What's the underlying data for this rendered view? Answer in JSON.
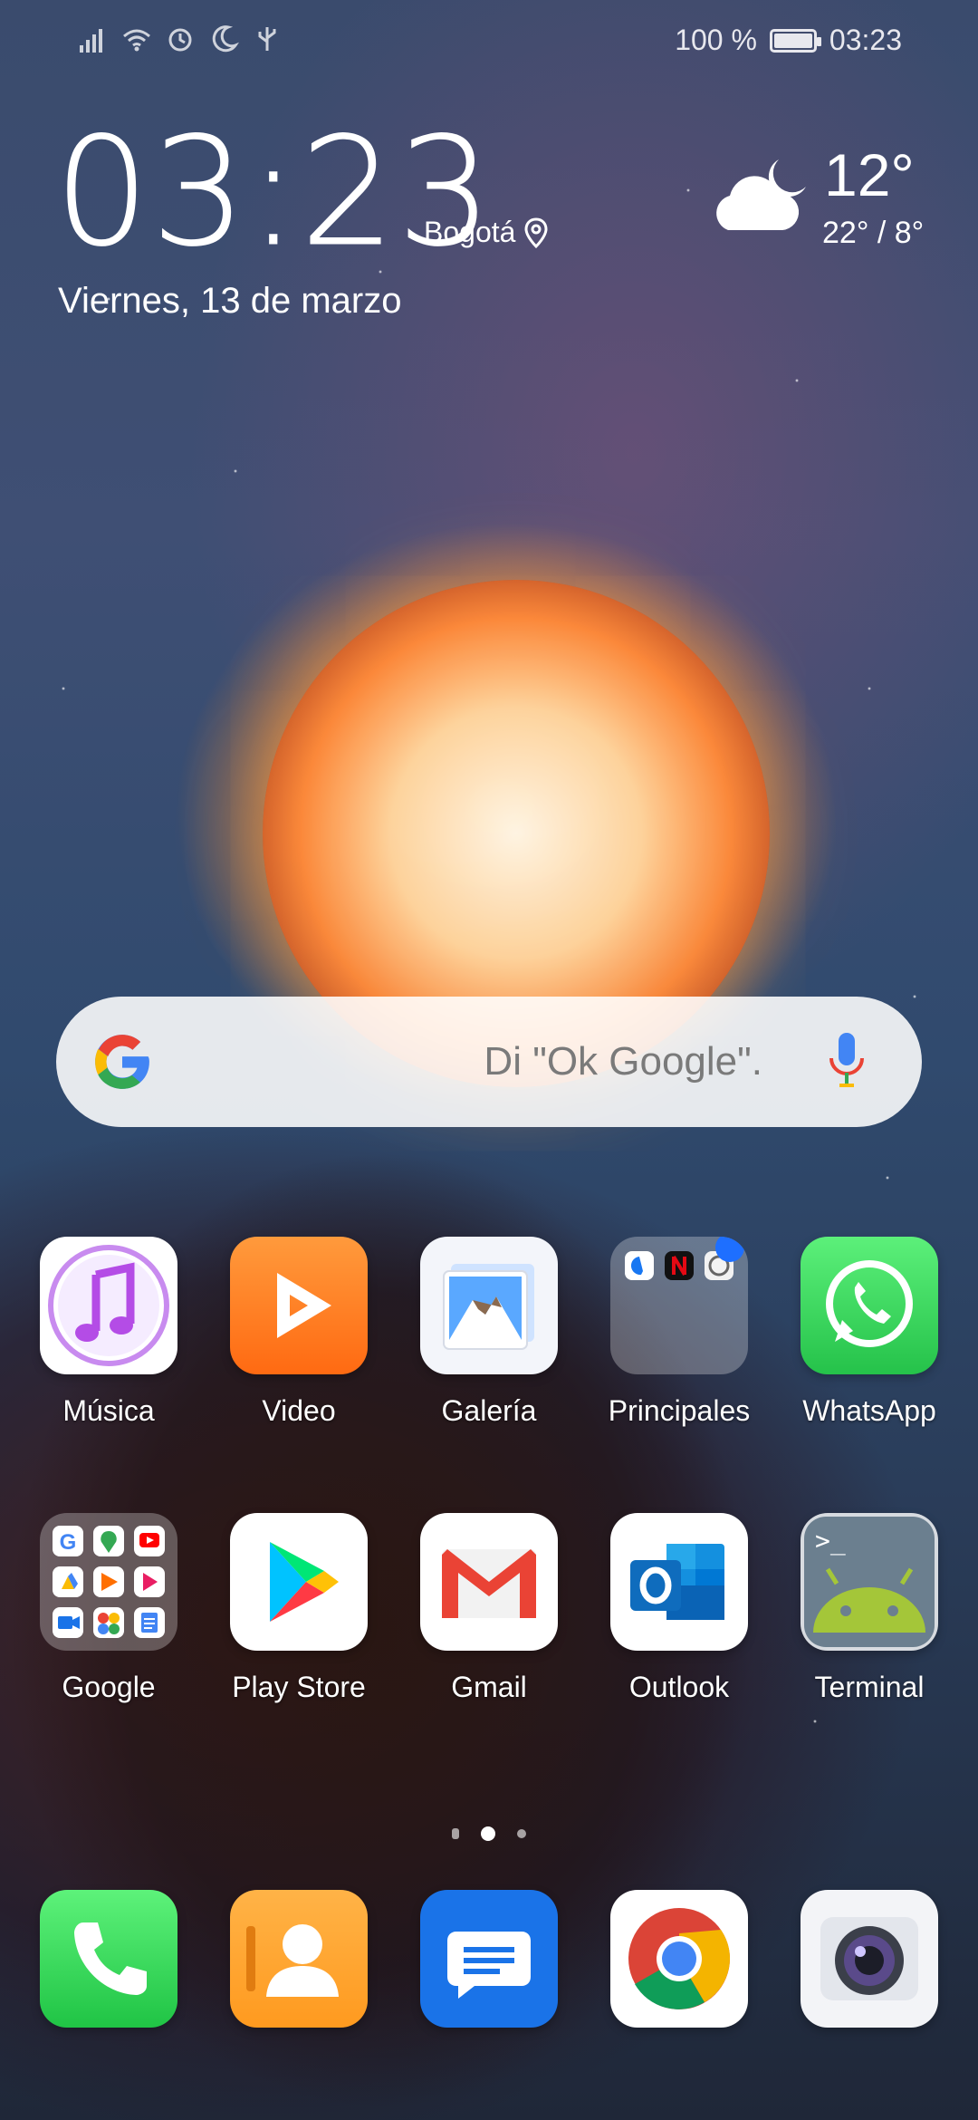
{
  "status_bar": {
    "battery_text": "100 %",
    "battery_level": 1.0,
    "time": "03:23",
    "icons": [
      "signal-icon",
      "wifi-icon",
      "alarm-icon",
      "do-not-disturb-icon",
      "usb-icon"
    ]
  },
  "clock_widget": {
    "time": "03:23",
    "city": "Bogotá",
    "date": "Viernes, 13 de marzo",
    "temperature": "12°",
    "range": "22° / 8°",
    "weather": "partly-cloudy-night-icon"
  },
  "search": {
    "hint": "Di \"Ok Google\"."
  },
  "apps_row1": [
    {
      "label": "Música",
      "icon": "music-icon"
    },
    {
      "label": "Video",
      "icon": "video-icon"
    },
    {
      "label": "Galería",
      "icon": "gallery-icon"
    },
    {
      "label": "Principales",
      "icon": "folder-icon"
    },
    {
      "label": "WhatsApp",
      "icon": "whatsapp-icon"
    }
  ],
  "apps_row2": [
    {
      "label": "Google",
      "icon": "google-folder-icon"
    },
    {
      "label": "Play Store",
      "icon": "play-store-icon"
    },
    {
      "label": "Gmail",
      "icon": "gmail-icon"
    },
    {
      "label": "Outlook",
      "icon": "outlook-icon"
    },
    {
      "label": "Terminal",
      "icon": "terminal-icon"
    }
  ],
  "dock": [
    {
      "icon": "phone-icon"
    },
    {
      "icon": "contacts-icon"
    },
    {
      "icon": "messages-icon"
    },
    {
      "icon": "chrome-icon"
    },
    {
      "icon": "camera-icon"
    }
  ],
  "colors": {
    "whatsapp": "#25D366",
    "video": "#FF7A1A",
    "messages": "#1A73E8",
    "phone": "#34C759",
    "contacts": "#FFA52A",
    "notification_dot": "#1E6FFF"
  }
}
